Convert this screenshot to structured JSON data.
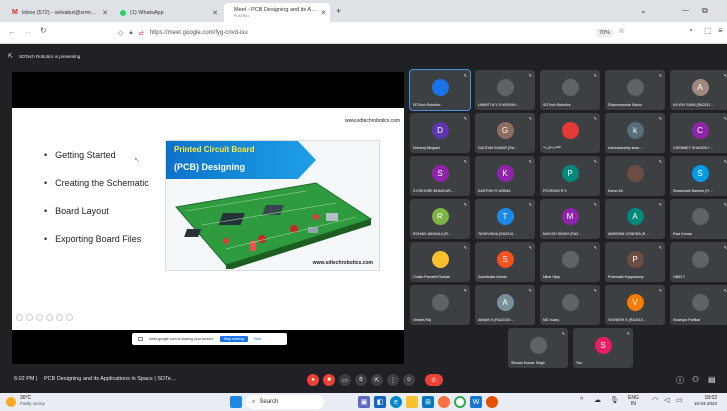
{
  "browser": {
    "tabs": [
      {
        "label": "Inbox (572) - selvakut@srmi…",
        "close": "✕",
        "icon_color": "#d93025"
      },
      {
        "label": "(1) WhatsApp",
        "close": "",
        "icon_color": "#25d366"
      },
      {
        "label": "Meet - PCB Designing and its A…",
        "sublabel": "PLAYING",
        "close": "✕",
        "icon_color": "#00897b"
      }
    ],
    "new_tab": "+",
    "url": "https://meet.google.com/fyg-cnvd-isu",
    "zoom": "70%",
    "window_controls": {
      "minimize": "—",
      "restore": "⧉",
      "chevron": "⌄"
    }
  },
  "meet": {
    "presenting_label": "SDTech Robotics is presenting",
    "slide": {
      "website": "www.sdtechrobotics.com",
      "bullets": [
        "Getting Started",
        "Creating the Schematic",
        "Board Layout",
        "Exporting Board Files"
      ],
      "banner_title": "Printed Circuit Board",
      "banner_subtitle": "(PCB) Designing",
      "image_website": "www.sdtechrobotics.com"
    },
    "sharing_bar": {
      "text": "meet.google.com is sharing your screen.",
      "stop": "Stop sharing",
      "hide": "Hide"
    },
    "participants": [
      {
        "name": "SDTech Robotics",
        "initial": "",
        "color": "#1a73e8",
        "photo": true
      },
      {
        "name": "UMMITI N V S KRISHN…",
        "initial": "",
        "color": "#5f6368",
        "photo": true
      },
      {
        "name": "SDTech Robotics",
        "initial": "",
        "color": "#5f6368",
        "photo": true
      },
      {
        "name": "Dharmananda Sahoo",
        "initial": "",
        "color": "#5f6368",
        "photo": true
      },
      {
        "name": "AYUSH SAINI (RA2011…",
        "initial": "A",
        "color": "#a1887f"
      },
      {
        "name": "Dheeraj Mingiani",
        "initial": "D",
        "color": "#5e35b1"
      },
      {
        "name": "GAUTAM KUMAR (RA…",
        "initial": "G",
        "color": "#8d6e63"
      },
      {
        "name": "சுப்பிரமணி",
        "initial": "",
        "color": "#e53935",
        "photo": true
      },
      {
        "name": "krishnamurthy shan…",
        "initial": "k",
        "color": "#546e7a"
      },
      {
        "name": "CHENMEY SHANDILY…",
        "initial": "C",
        "color": "#8e24aa"
      },
      {
        "name": "S KISHORE BHASKAR…",
        "initial": "S",
        "color": "#8e24aa"
      },
      {
        "name": "KARTHIK R VARMA",
        "initial": "K",
        "color": "#8e24aa"
      },
      {
        "name": "POORANI R S",
        "initial": "P",
        "color": "#00897b"
      },
      {
        "name": "Karan MJ",
        "initial": "",
        "color": "#6d4c41",
        "photo": true
      },
      {
        "name": "Shashwath Naveen (R…",
        "initial": "S",
        "color": "#039be5"
      },
      {
        "name": "ROHAN JANGALA (R…",
        "initial": "R",
        "color": "#7cb342"
      },
      {
        "name": "TASHVIKHA (RA2010…",
        "initial": "T",
        "color": "#1e88e5"
      },
      {
        "name": "MAYURI SINGH (RA2…",
        "initial": "M",
        "color": "#8e24aa"
      },
      {
        "name": "ABHIRAM VONDRA (R…",
        "initial": "A",
        "color": "#00897b"
      },
      {
        "name": "Ravi Kumar",
        "initial": "",
        "color": "#5f6368",
        "photo": true
      },
      {
        "name": "Challa Parvathi Rudrah",
        "initial": "",
        "color": "#fbc02d",
        "photo": true
      },
      {
        "name": "Sachibrata Nanda",
        "initial": "S",
        "color": "#f4511e"
      },
      {
        "name": "Nihal Vijay",
        "initial": "",
        "color": "#5f6368",
        "photo": true
      },
      {
        "name": "Pramnath Kuppusamy",
        "initial": "P",
        "color": "#6d4c41"
      },
      {
        "name": "LIBIN T",
        "initial": "",
        "color": "#5f6368",
        "photo": true
      },
      {
        "name": "Vishwa Raj",
        "initial": "",
        "color": "#5f6368",
        "photo": true
      },
      {
        "name": "Abhijith S (RA20100…",
        "initial": "A",
        "color": "#78909c"
      },
      {
        "name": "MD nuazy",
        "initial": "",
        "color": "#5f6368",
        "photo": true
      },
      {
        "name": "VIGNESH S (RA2010…",
        "initial": "V",
        "color": "#f57c00"
      },
      {
        "name": "Swarupa Parlikar",
        "initial": "",
        "color": "#5f6368",
        "photo": true
      },
      {
        "name": "Shivam Kumar Singh",
        "initial": "",
        "color": "#5f6368",
        "photo": true
      },
      {
        "name": "You",
        "initial": "S",
        "color": "#e91e63"
      }
    ],
    "bottom_bar": {
      "time": "6:02 PM",
      "title": "PCB Designing and its Applications in Space | SDTe…"
    }
  },
  "taskbar": {
    "weather_temp": "30°C",
    "weather_text": "Partly sunny",
    "search": "Search",
    "lang": "ENG",
    "region": "IN",
    "time": "18:02",
    "date": "10-04-2023"
  }
}
